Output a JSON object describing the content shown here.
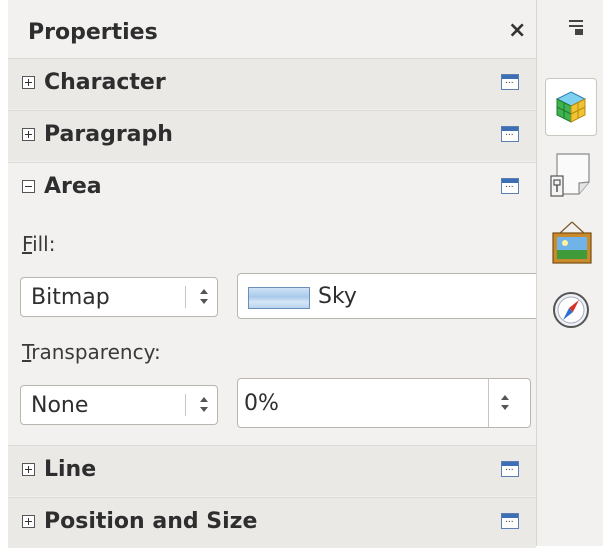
{
  "panel": {
    "title": "Properties",
    "close_glyph": "×"
  },
  "sections": {
    "character": {
      "label": "Character",
      "state": "collapsed"
    },
    "paragraph": {
      "label": "Paragraph",
      "state": "collapsed"
    },
    "area": {
      "label": "Area",
      "state": "expanded",
      "fill_label_first": "F",
      "fill_label_rest": "ill:",
      "fill_type": "Bitmap",
      "fill_bitmap": "Sky",
      "transparency_label_first": "T",
      "transparency_label_rest": "ransparency:",
      "transparency_type": "None",
      "transparency_value": "0%"
    },
    "line": {
      "label": "Line",
      "state": "collapsed"
    },
    "position_size": {
      "label": "Position and Size",
      "state": "collapsed"
    }
  },
  "deck": {
    "icons": [
      "sidebar-menu-icon",
      "properties-icon",
      "styles-icon",
      "gallery-icon",
      "navigator-icon"
    ]
  }
}
